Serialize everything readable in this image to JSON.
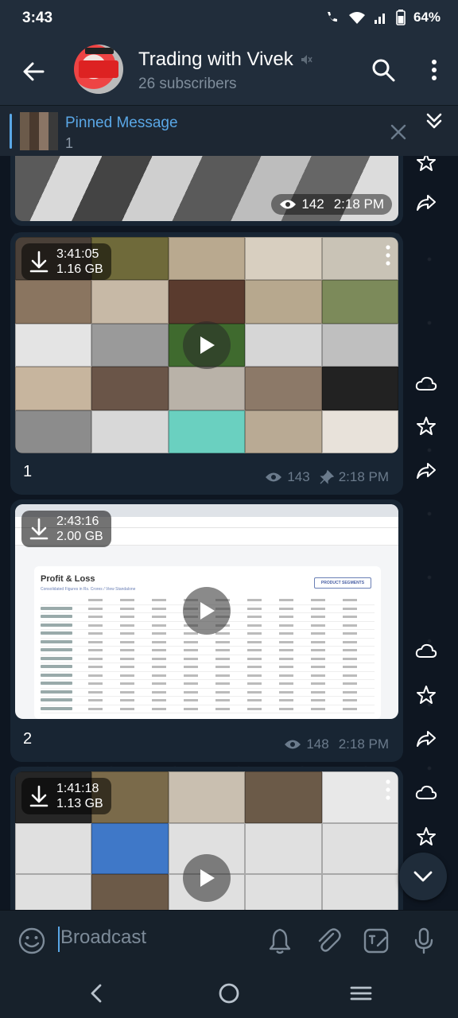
{
  "status_bar": {
    "time": "3:43",
    "battery": "64%"
  },
  "header": {
    "title": "Trading with Vivek",
    "subscribers": "26 subscribers",
    "icons": [
      "back-arrow-icon",
      "mute-icon",
      "search-icon",
      "more-vert-icon"
    ]
  },
  "pinned": {
    "title": "Pinned Message",
    "subtitle": "1"
  },
  "messages": [
    {
      "views": "142",
      "time": "2:18 PM"
    },
    {
      "duration": "3:41:05",
      "size": "1.16 GB",
      "caption": "1",
      "views": "143",
      "time": "2:18 PM"
    },
    {
      "duration": "2:43:16",
      "size": "2.00 GB",
      "caption": "2",
      "views": "148",
      "time": "2:18 PM",
      "screenshot_heading": "Profit & Loss",
      "screenshot_subheading": "Consolidated Figures in Rs. Crores / View Standalone",
      "screenshot_button": "PRODUCT SEGMENTS"
    },
    {
      "duration": "1:41:18",
      "size": "1.13 GB"
    }
  ],
  "composer": {
    "placeholder": "Broadcast"
  },
  "colors": {
    "accent": "#5aa7e6",
    "background": "#0e1621",
    "bubble": "#182533",
    "header": "#212d3b"
  }
}
